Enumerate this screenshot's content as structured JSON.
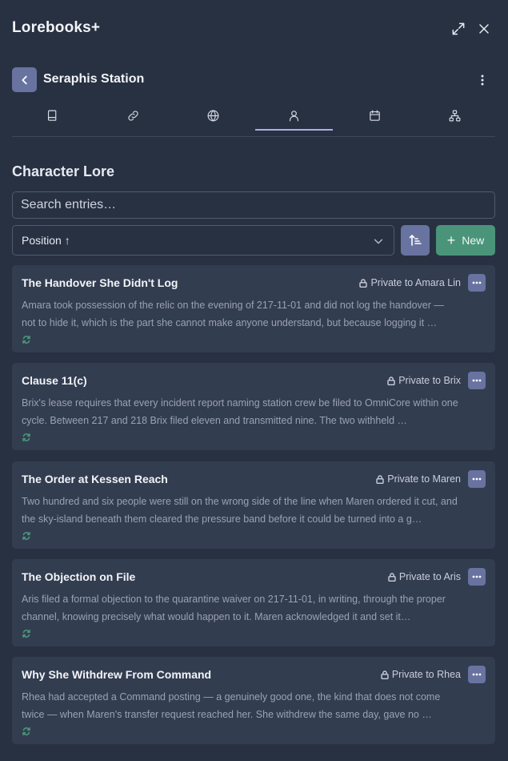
{
  "app": {
    "title": "Lorebooks+"
  },
  "book": {
    "title": "Seraphis Station"
  },
  "tabs": [
    {
      "icon": "book-icon",
      "active": false
    },
    {
      "icon": "link-icon",
      "active": false
    },
    {
      "icon": "globe-icon",
      "active": false
    },
    {
      "icon": "user-icon",
      "active": true
    },
    {
      "icon": "calendar-icon",
      "active": false
    },
    {
      "icon": "hierarchy-icon",
      "active": false
    }
  ],
  "section": {
    "title": "Character Lore"
  },
  "search": {
    "placeholder": "Search entries…",
    "value": ""
  },
  "sort": {
    "value": "Position ↑"
  },
  "new_button": {
    "label": "New"
  },
  "colors": {
    "accent": "#6873a0",
    "success": "#4a957a",
    "background": "#283142",
    "card": "#333d50"
  },
  "entries": [
    {
      "title": "The Handover She Didn't Log",
      "privacy": "Private to Amara Lin",
      "body": "Amara took possession of the relic on the evening of 217-11-01 and did not log the handover — not to hide it, which is the part she cannot make anyone understand, but because logging it …"
    },
    {
      "title": "Clause 11(c)",
      "privacy": "Private to Brix",
      "body": "Brix's lease requires that every incident report naming station crew be filed to OmniCore within one cycle. Between 217 and 218 Brix filed eleven and transmitted nine. The two withheld …"
    },
    {
      "title": "The Order at Kessen Reach",
      "privacy": "Private to Maren",
      "body": "Two hundred and six people were still on the wrong side of the line when Maren ordered it cut, and the sky-island beneath them cleared the pressure band before it could be turned into a g…"
    },
    {
      "title": "The Objection on File",
      "privacy": "Private to Aris",
      "body": "Aris filed a formal objection to the quarantine waiver on 217-11-01, in writing, through the proper channel, knowing precisely what would happen to it. Maren acknowledged it and set it…"
    },
    {
      "title": "Why She Withdrew From Command",
      "privacy": "Private to Rhea",
      "body": "Rhea had accepted a Command posting — a genuinely good one, the kind that does not come twice — when Maren's transfer request reached her. She withdrew the same day, gave no …"
    }
  ]
}
